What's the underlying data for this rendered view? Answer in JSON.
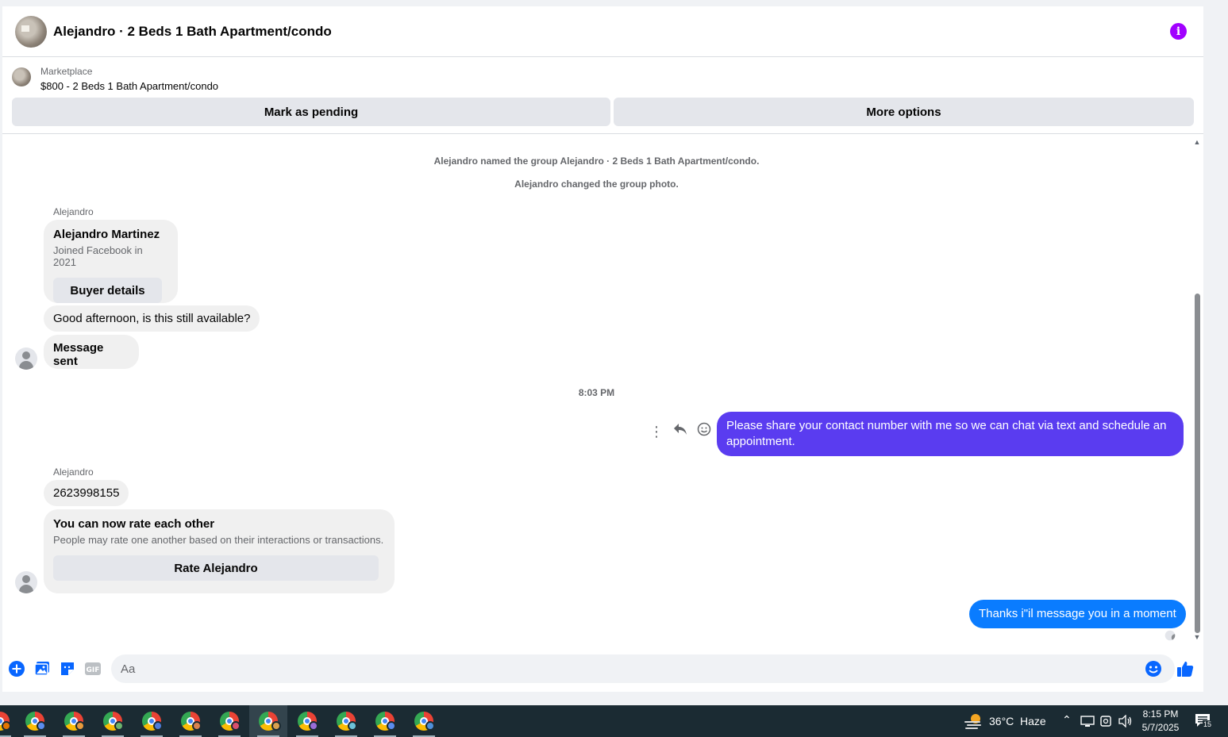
{
  "header": {
    "title": "Alejandro · 2 Beds 1 Bath Apartment/condo"
  },
  "marketplace": {
    "label": "Marketplace",
    "item": "$800 - 2 Beds 1 Bath Apartment/condo",
    "mark_pending": "Mark as pending",
    "more_options": "More options"
  },
  "chat": {
    "system_1": "Alejandro named the group Alejandro · 2 Beds 1 Bath Apartment/condo.",
    "system_2": "Alejandro changed the group photo.",
    "sender_1": "Alejandro",
    "card_name": "Alejandro Martinez",
    "card_joined": "Joined Facebook in 2021",
    "card_button": "Buyer details",
    "msg_1": "Good afternoon, is this still available?",
    "msg_2": "Message sent",
    "timestamp": "8:03 PM",
    "outgoing_1": "Please share your contact number with me so we can chat via text and schedule an appointment.",
    "sender_2": "Alejandro",
    "msg_3": "2623998155",
    "rate_title": "You can now rate each other",
    "rate_sub": "People may rate one another based on their interactions or transactions.",
    "rate_button": "Rate Alejandro",
    "outgoing_2": "Thanks i\"il message you in a moment"
  },
  "composer": {
    "placeholder": "Aa"
  },
  "taskbar": {
    "weather_temp": "36°C",
    "weather_desc": "Haze",
    "time": "8:15 PM",
    "date": "5/7/2025",
    "notification_count": "15"
  },
  "colors": {
    "outgoing_purple": "#5a3cf0",
    "outgoing_blue": "#0a7cff",
    "accent": "#0866ff",
    "info": "#a100ff"
  }
}
